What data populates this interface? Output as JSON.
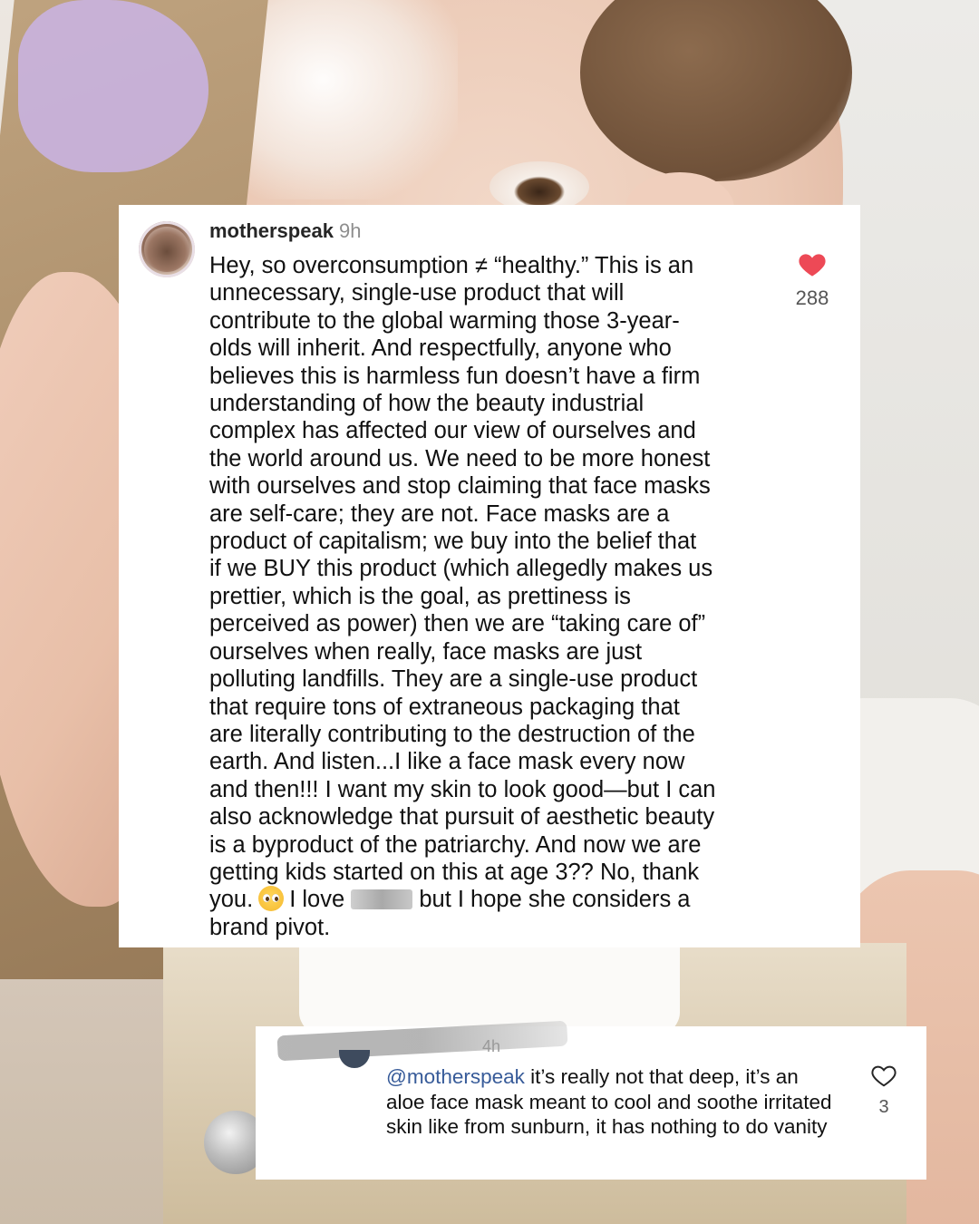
{
  "colors": {
    "like_red": "#ED4956",
    "mention_blue": "#375B99",
    "username_text": "#262626",
    "muted_text": "#8E8E8E"
  },
  "main_comment": {
    "username": "motherspeak",
    "time": "9h",
    "text_before_emoji": "Hey, so overconsumption ≠ “healthy.” This is an\nunnecessary, single-use product that will\ncontribute to the global warming those 3-year-\nolds will inherit.  And respectfully, anyone who\nbelieves this is harmless fun doesn’t have a firm\nunderstanding of how the beauty industrial\ncomplex has affected our view of ourselves and\nthe world around us. We need to be more honest\nwith ourselves and stop claiming that face masks\nare self-care; they are not. Face masks are a\nproduct of capitalism; we buy into the belief that\nif we BUY this product (which allegedly makes us\nprettier, which is the goal, as prettiness is\nperceived as power) then we are “taking care of”\nourselves when really, face masks are just\npolluting landfills. They are a single-use product\nthat require tons of extraneous packaging that\nare literally contributing to the destruction of the\nearth. And listen...I like a face mask every now\nand then!!! I want my skin to look good—but I can\nalso acknowledge that pursuit of aesthetic beauty\nis a byproduct of the patriarchy. And now we are\ngetting kids started on this at age 3?? No, thank\nyou.",
    "emoji": "pleading-face-emoji",
    "text_after_emoji": "I love",
    "text_after_redaction": "but I hope she considers a\nbrand pivot.",
    "like_icon": "heart-filled-icon",
    "like_count": "288"
  },
  "reply_comment": {
    "time_partial": "4h",
    "mention": "@motherspeak",
    "text": " it’s really not that deep, it’s an aloe face mask meant to cool and soothe irritated skin like from sunburn, it has nothing to do vanity",
    "like_icon": "heart-outline-icon",
    "like_count": "3"
  }
}
